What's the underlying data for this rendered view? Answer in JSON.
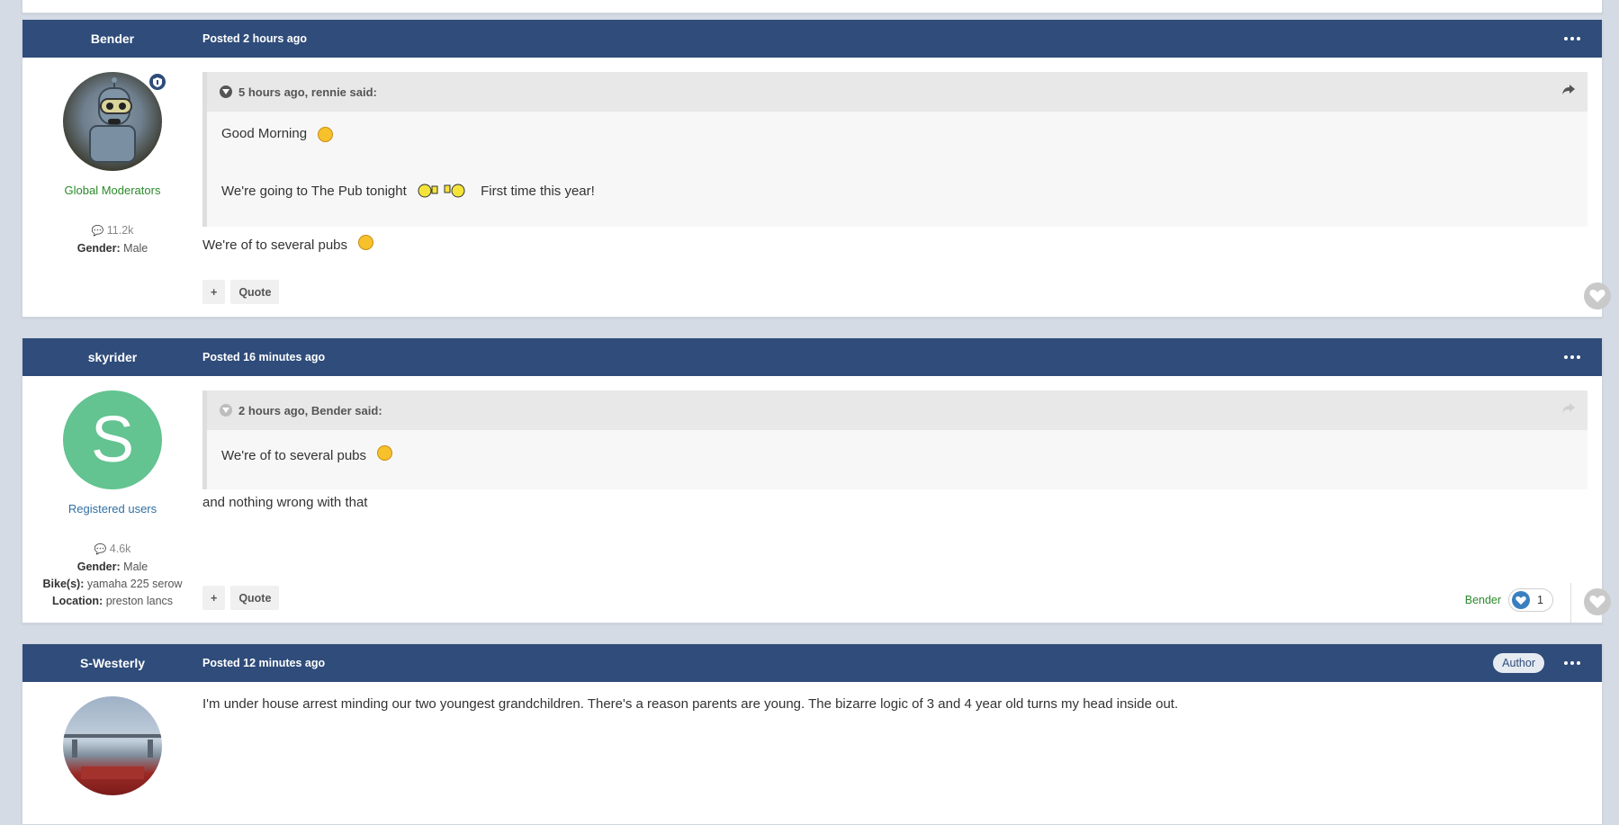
{
  "posts": [
    {
      "author": "Bender",
      "date": "Posted 2 hours ago",
      "group": "Global Moderators",
      "post_count": "11.2k",
      "gender_label": "Gender:",
      "gender": "Male",
      "quote": {
        "header": "5 hours ago, rennie said:",
        "line1": "Good Morning",
        "line2": "We're going to The Pub tonight",
        "line2_tail": "First time this year!"
      },
      "text": "We're of to several pubs",
      "buttons": {
        "plus": "+",
        "quote": "Quote"
      }
    },
    {
      "author": "skyrider",
      "date": "Posted 16 minutes ago",
      "avatar_letter": "S",
      "group": "Registered users",
      "post_count": "4.6k",
      "gender_label": "Gender:",
      "gender": "Male",
      "bikes_label": "Bike(s):",
      "bikes": "yamaha 225 serow",
      "location_label": "Location:",
      "location": "preston lancs",
      "quote": {
        "header": "2 hours ago, Bender said:",
        "line1": "We're of to several pubs"
      },
      "text": "and nothing wrong with that",
      "buttons": {
        "plus": "+",
        "quote": "Quote"
      },
      "reaction": {
        "liker": "Bender",
        "count": "1"
      }
    },
    {
      "author": "S-Westerly",
      "date": "Posted 12 minutes ago",
      "badge": "Author",
      "text": "I'm under house arrest minding our two youngest grandchildren. There's a reason parents are young. The bizarre logic of 3 and 4 year old turns my head inside out."
    }
  ],
  "colors": {
    "header": "#2f4c7a",
    "moderator": "#2b8a2b",
    "registered": "#2f6fa4",
    "avatar_s": "#63c391"
  }
}
